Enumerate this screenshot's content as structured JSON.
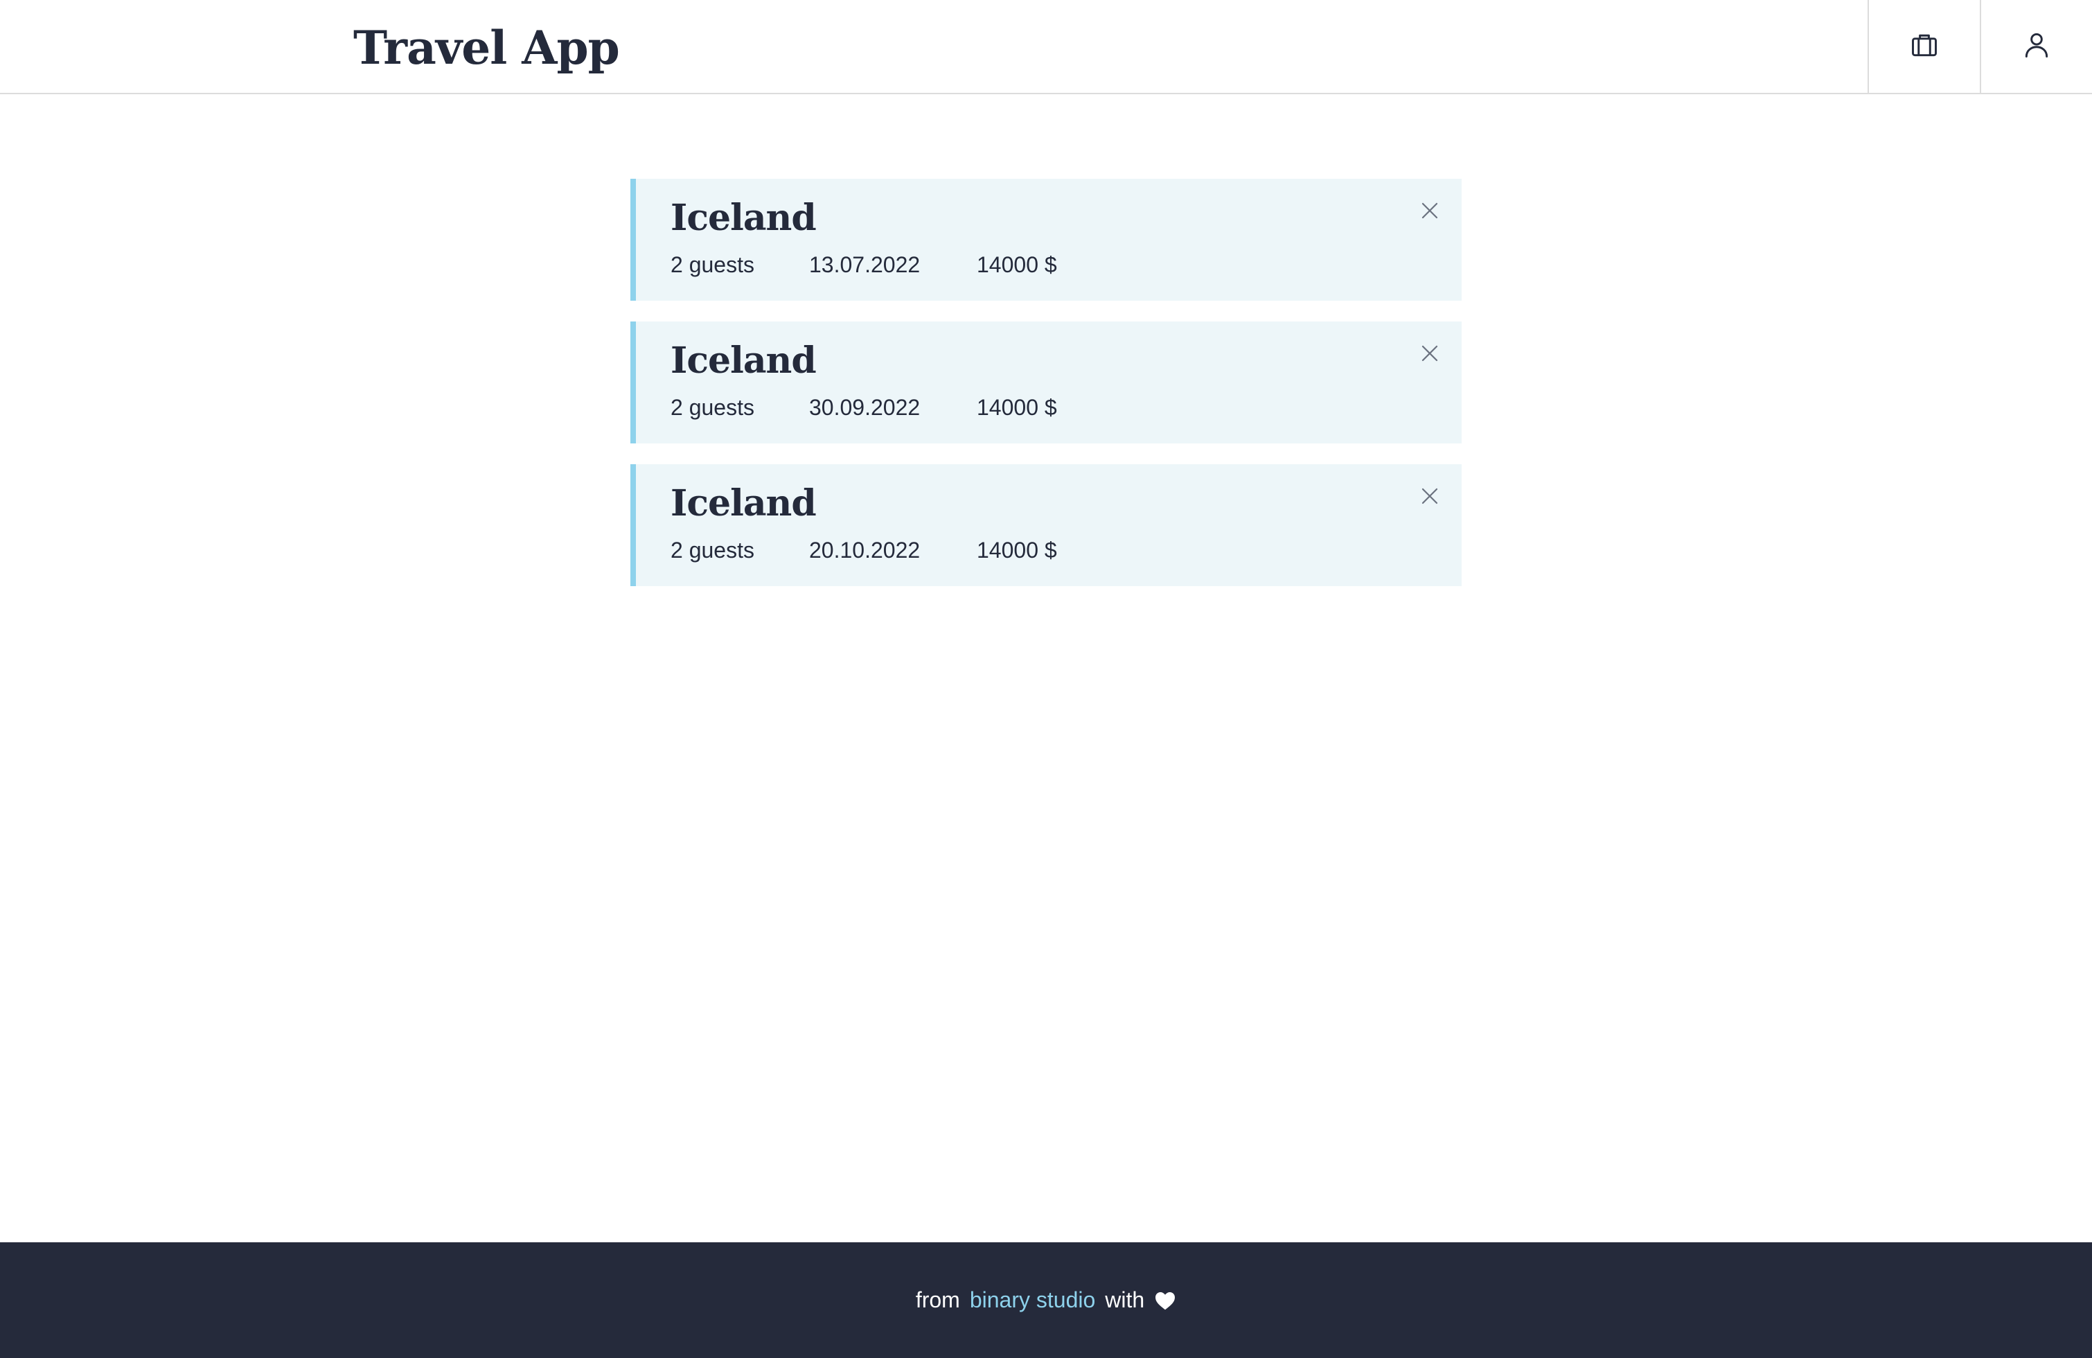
{
  "header": {
    "logo": "Travel App",
    "nav": [
      {
        "name": "bookings",
        "icon": "briefcase-icon"
      },
      {
        "name": "profile",
        "icon": "user-icon"
      }
    ]
  },
  "bookings": [
    {
      "title": "Iceland",
      "guests": "2 guests",
      "date": "13.07.2022",
      "price": "14000 $"
    },
    {
      "title": "Iceland",
      "guests": "2 guests",
      "date": "30.09.2022",
      "price": "14000 $"
    },
    {
      "title": "Iceland",
      "guests": "2 guests",
      "date": "20.10.2022",
      "price": "14000 $"
    }
  ],
  "footer": {
    "from": "from",
    "link": "binary studio",
    "with": "with",
    "icon": "heart-icon"
  },
  "colors": {
    "accent": "#8ed2ec",
    "card_bg": "#edf6f9",
    "text_dark": "#242a3b",
    "footer_bg": "#252a3b"
  }
}
